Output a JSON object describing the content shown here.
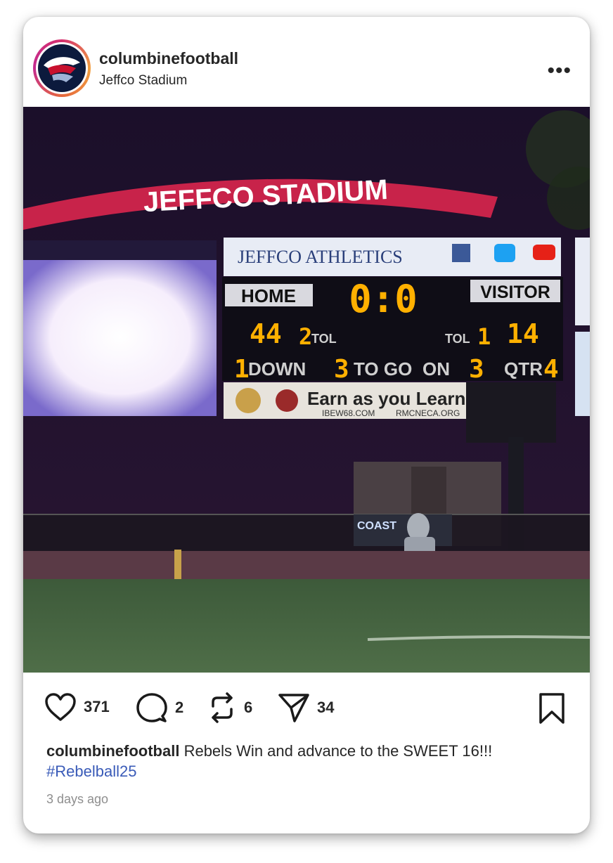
{
  "post": {
    "username": "columbinefootball",
    "location": "Jeffco Stadium",
    "more_label": "•••",
    "likes": "371",
    "comments": "2",
    "reposts": "6",
    "shares": "34",
    "caption_user": "columbinefootball",
    "caption_text": "Rebels Win and advance to the SWEET 16!!!",
    "hashtag": "#Rebelball25",
    "time_ago": "3 days ago"
  },
  "photo": {
    "arch_text": "JEFFCO STADIUM",
    "sponsor_top": "JEFFCO ATHLETICS",
    "home_label": "HOME",
    "visitor_label": "VISITOR",
    "clock": "0:0",
    "home_score": "44",
    "home_tol": "2",
    "visitor_score": "14",
    "visitor_tol": "1",
    "tol_label": "TOL",
    "down": "1",
    "down_label": "DOWN",
    "to_go": "3",
    "to_go_label": "TO GO",
    "on_label": "ON",
    "ball_on": "3",
    "qtr_label": "QTR",
    "qtr": "4",
    "sponsor_bottom": "Earn as you Learn",
    "sponsor_url_1": "IBEW68.COM",
    "sponsor_url_2": "RMCNECA.ORG",
    "fence_sign": "COAST"
  },
  "colors": {
    "accent_link": "#3a5bb8",
    "scoreboard_digit": "#ffb000",
    "arch": "#c8234a"
  }
}
